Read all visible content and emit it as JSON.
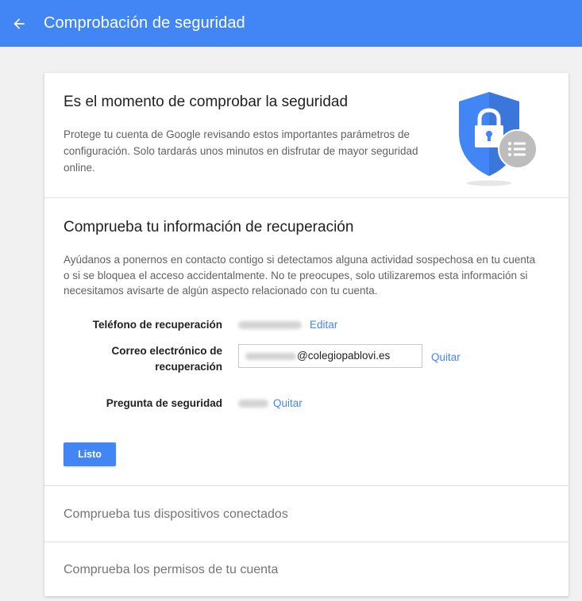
{
  "app_bar": {
    "title": "Comprobación de seguridad",
    "back_icon": "arrow-left-icon",
    "color": "#4285f4"
  },
  "intro": {
    "title": "Es el momento de comprobar la seguridad",
    "description": "Protege tu cuenta de Google revisando estos importantes parámetros de configuración. Solo tardarás unos minutos en disfrutar de mayor seguridad online.",
    "illustration_icon": "shield-lock-icon"
  },
  "recovery": {
    "title": "Comprueba tu información de recuperación",
    "description": "Ayúdanos a ponernos en contacto contigo si detectamos alguna actividad sospechosa en tu cuenta o si se bloquea el acceso accidentalmente. No te preocupes, solo utilizaremos esta información si necesitamos avisarte de algún aspecto relacionado con tu cuenta.",
    "phone": {
      "label": "Teléfono de recuperación",
      "action": "Editar"
    },
    "email": {
      "label_line1": "Correo electrónico de",
      "label_line2": "recuperación",
      "value_suffix": "@colegiopablovi.es",
      "action": "Quitar"
    },
    "question": {
      "label": "Pregunta de seguridad",
      "action": "Quitar"
    },
    "done_button": "Listo"
  },
  "sections": {
    "devices": "Comprueba tus dispositivos conectados",
    "permissions": "Comprueba los permisos de tu cuenta"
  },
  "colors": {
    "accent": "#4285f4",
    "shield": "#4285f4",
    "badge": "#bdbdbd"
  }
}
